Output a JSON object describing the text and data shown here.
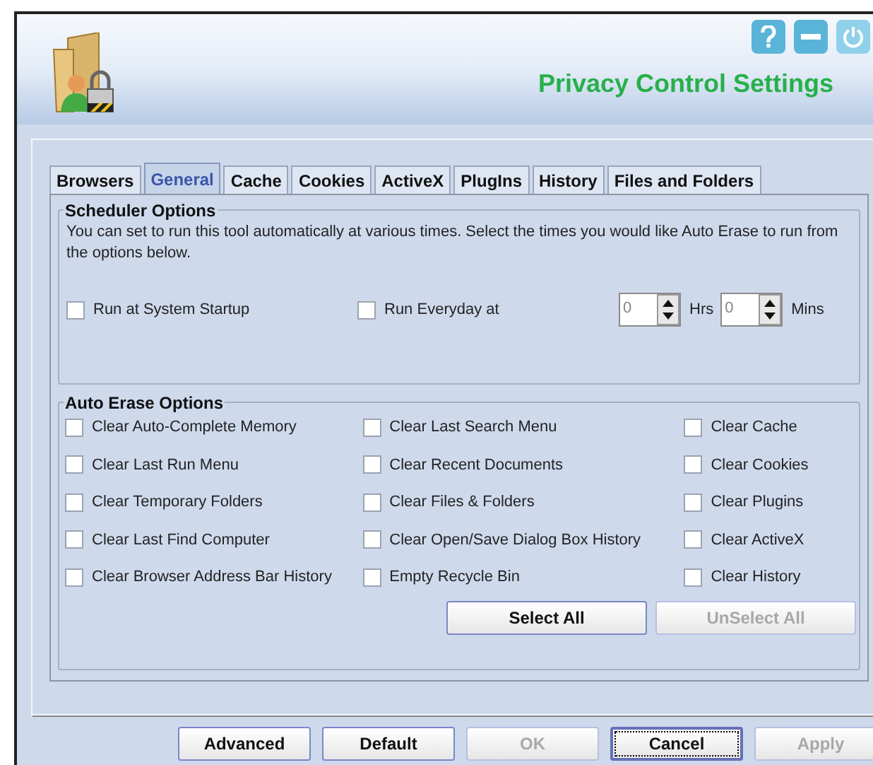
{
  "header": {
    "title": "Privacy Control Settings"
  },
  "tabs": [
    {
      "label": "Browsers",
      "selected": false
    },
    {
      "label": "General",
      "selected": true
    },
    {
      "label": "Cache",
      "selected": false
    },
    {
      "label": "Cookies",
      "selected": false
    },
    {
      "label": "ActiveX",
      "selected": false
    },
    {
      "label": "PlugIns",
      "selected": false
    },
    {
      "label": "History",
      "selected": false
    },
    {
      "label": "Files and Folders",
      "selected": false
    }
  ],
  "scheduler": {
    "title": "Scheduler Options",
    "description": "You can set to run this tool automatically at various times. Select the times you would like Auto Erase to run from the options below.",
    "startup": {
      "label": "Run at System Startup",
      "checked": false
    },
    "everyday": {
      "label": "Run Everyday at",
      "checked": false
    },
    "spinners": [
      {
        "value": "0",
        "unit": "Hrs"
      },
      {
        "value": "0",
        "unit": "Mins"
      }
    ]
  },
  "auto_erase": {
    "title": "Auto Erase Options",
    "columns": [
      [
        {
          "label": "Clear Auto-Complete Memory",
          "checked": false
        },
        {
          "label": "Clear Last Run Menu",
          "checked": false
        },
        {
          "label": "Clear Temporary Folders",
          "checked": false
        },
        {
          "label": "Clear Last Find Computer",
          "checked": false
        },
        {
          "label": "Clear Browser Address Bar History",
          "checked": false
        }
      ],
      [
        {
          "label": "Clear Last Search Menu",
          "checked": false
        },
        {
          "label": "Clear Recent Documents",
          "checked": false
        },
        {
          "label": "Clear Files & Folders",
          "checked": false
        },
        {
          "label": "Clear Open/Save Dialog Box History",
          "checked": false
        },
        {
          "label": "Empty Recycle Bin",
          "checked": false
        }
      ],
      [
        {
          "label": "Clear Cache",
          "checked": false
        },
        {
          "label": "Clear Cookies",
          "checked": false
        },
        {
          "label": "Clear Plugins",
          "checked": false
        },
        {
          "label": "Clear ActiveX",
          "checked": false
        },
        {
          "label": "Clear History",
          "checked": false
        }
      ]
    ],
    "buttons": [
      {
        "label": "Select All",
        "disabled": false
      },
      {
        "label": "UnSelect All",
        "disabled": true
      }
    ]
  },
  "footer_buttons": [
    {
      "label": "Advanced",
      "disabled": false,
      "focused": false
    },
    {
      "label": "Default",
      "disabled": false,
      "focused": false
    },
    {
      "label": "OK",
      "disabled": true,
      "focused": false
    },
    {
      "label": "Cancel",
      "disabled": false,
      "focused": true
    },
    {
      "label": "Apply",
      "disabled": true,
      "focused": false
    }
  ]
}
